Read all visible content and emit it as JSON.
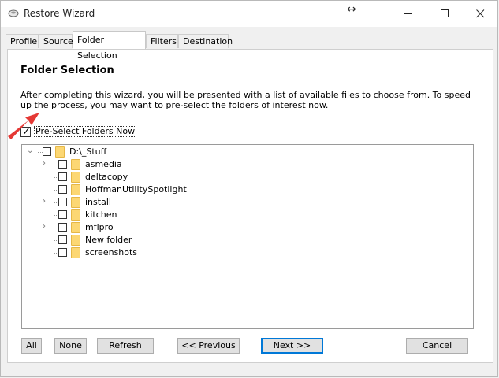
{
  "window": {
    "title": "Restore Wizard",
    "resize_glyph": "↔"
  },
  "tabs": [
    {
      "label": "Profile"
    },
    {
      "label": "Source"
    },
    {
      "label": "Folder Selection",
      "active": true
    },
    {
      "label": "Filters"
    },
    {
      "label": "Destination"
    }
  ],
  "main": {
    "heading": "Folder Selection",
    "description": "After completing this wizard, you will be presented with a list of available files to choose from. To speed up the process, you may want to pre-select the folders of interest now.",
    "preselect": {
      "label": "Pre-Select Folders Now",
      "checked": true
    }
  },
  "tree": {
    "root": {
      "label": "D:\\_Stuff",
      "expanded": true,
      "checked": false
    },
    "children": [
      {
        "label": "asmedia",
        "expandable": true,
        "checked": false
      },
      {
        "label": "deltacopy",
        "expandable": false,
        "checked": false
      },
      {
        "label": "HoffmanUtilitySpotlight",
        "expandable": false,
        "checked": false
      },
      {
        "label": "install",
        "expandable": true,
        "checked": false
      },
      {
        "label": "kitchen",
        "expandable": false,
        "checked": false
      },
      {
        "label": "mflpro",
        "expandable": true,
        "checked": false
      },
      {
        "label": "New folder",
        "expandable": false,
        "checked": false
      },
      {
        "label": "screenshots",
        "expandable": false,
        "checked": false
      }
    ]
  },
  "buttons": {
    "all": "All",
    "none": "None",
    "refresh": "Refresh",
    "previous": "<< Previous",
    "next": "Next >>",
    "cancel": "Cancel"
  }
}
